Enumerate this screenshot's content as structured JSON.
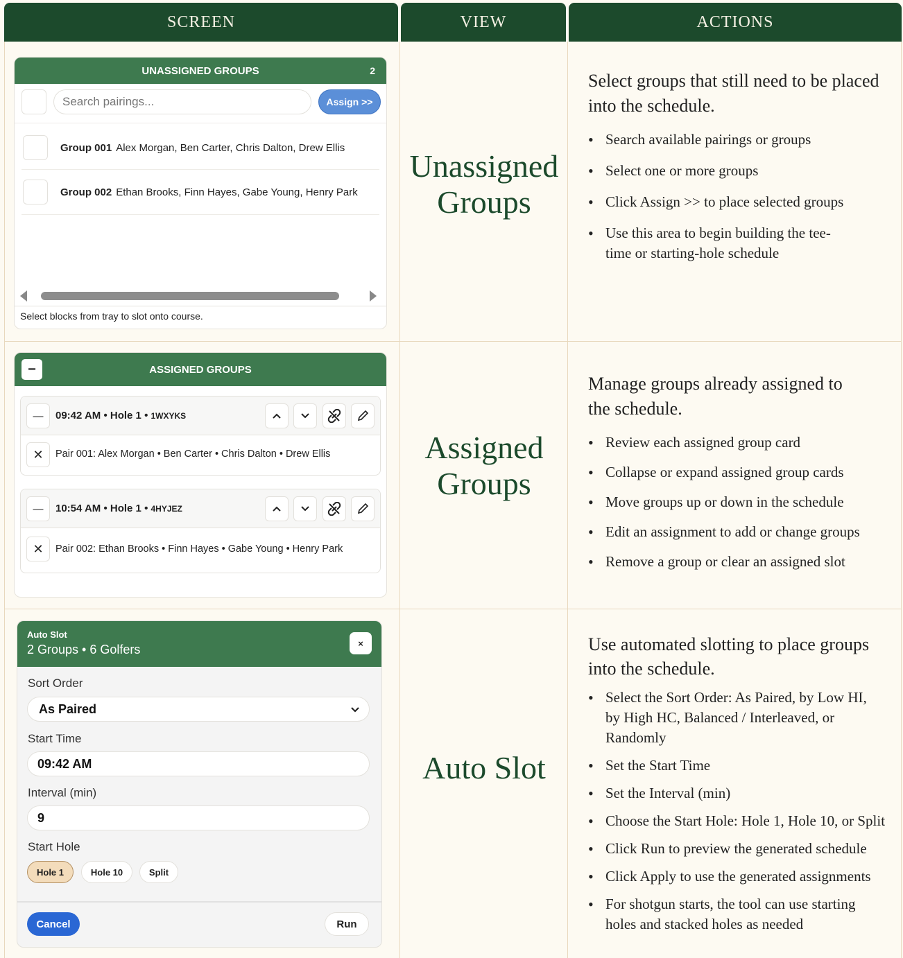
{
  "headers": {
    "screen": "SCREEN",
    "view": "VIEW",
    "actions": "ACTIONS"
  },
  "unassigned": {
    "title": "UNASSIGNED GROUPS",
    "count": "2",
    "search_placeholder": "Search pairings...",
    "assign_label": "Assign >>",
    "groups": [
      {
        "id": "Group 001",
        "players": "Alex Morgan, Ben Carter, Chris Dalton, Drew Ellis"
      },
      {
        "id": "Group 002",
        "players": "Ethan Brooks, Finn Hayes, Gabe Young, Henry Park"
      }
    ],
    "hint": "Select blocks from tray to slot onto course.",
    "view_line1": "Unassigned",
    "view_line2": "Groups",
    "lead": "Select groups that still need to be placed into the schedule.",
    "bullets": [
      "Search available pairings or groups",
      "Select one or more groups",
      "Click Assign >> to place selected groups",
      "Use this area to begin building the tee-time or starting-hole schedule"
    ]
  },
  "assigned": {
    "title": "ASSIGNED GROUPS",
    "cards": [
      {
        "time": "09:42 AM • Hole 1 • ",
        "code": "1WXYKS",
        "pair": "Pair 001: Alex Morgan • Ben Carter • Chris Dalton • Drew Ellis"
      },
      {
        "time": "10:54 AM • Hole 1 • ",
        "code": "4HYJEZ",
        "pair": "Pair 002: Ethan Brooks • Finn Hayes • Gabe Young • Henry Park"
      }
    ],
    "view_line1": "Assigned",
    "view_line2": "Groups",
    "lead": "Manage groups already assigned to the schedule.",
    "bullets": [
      "Review each assigned group card",
      "Collapse or expand assigned group cards",
      "Move groups up or down in the schedule",
      "Edit an assignment to add or change groups",
      "Remove a group or clear an assigned slot"
    ]
  },
  "auto": {
    "title": "Auto Slot",
    "subtitle": "2 Groups • 6 Golfers",
    "close": "×",
    "sort_label": "Sort Order",
    "sort_value": "As Paired",
    "start_label": "Start Time",
    "start_value": "09:42 AM",
    "interval_label": "Interval (min)",
    "interval_value": "9",
    "hole_label": "Start Hole",
    "hole_options": [
      "Hole 1",
      "Hole 10",
      "Split"
    ],
    "hole_selected": "Hole 1",
    "cancel_label": "Cancel",
    "run_label": "Run",
    "view_line1": "Auto Slot",
    "lead": "Use automated slotting to place groups into the schedule.",
    "bullets": [
      "Select the Sort Order: As Paired, by Low HI, by High HC, Balanced / Interleaved, or Randomly",
      "Set the Start Time",
      "Set the Interval (min)",
      "Choose the Start Hole: Hole 1, Hole 10, or Split",
      "Click Run to preview the generated schedule",
      "Click Apply to use the generated assignments",
      "For shotgun starts, the tool can use starting holes and stacked holes as needed"
    ]
  },
  "colors": {
    "dark_green": "#1c4a2c",
    "mid_green": "#3e7a4f",
    "blue": "#2a67d4",
    "accent_tan": "#f3dcbb",
    "background": "#fdfaf2"
  }
}
